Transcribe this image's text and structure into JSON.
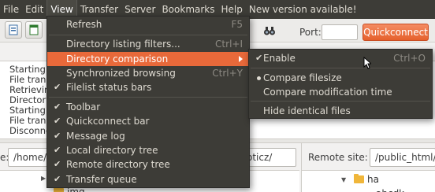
{
  "menubar": {
    "items": [
      "File",
      "Edit",
      "View",
      "Transfer",
      "Server",
      "Bookmarks",
      "Help",
      "New version available!"
    ],
    "active": "View"
  },
  "toolbar": {
    "port_label": "Port:",
    "connect_label": "Quickconnect"
  },
  "log": {
    "lines": [
      "Starting",
      "File trans",
      "Retrievin",
      "Director",
      "Starting",
      "File trans",
      "Disconne"
    ]
  },
  "local": {
    "label": "e:",
    "path": "/home/m",
    "path_tail": "oticz/",
    "tree": [
      {
        "name": "img",
        "type": "folder"
      }
    ]
  },
  "remote": {
    "label": "Remote site:",
    "path": "/public_html/mi",
    "tree": [
      {
        "name": "ha",
        "type": "folder"
      },
      {
        "name": "abcdk",
        "type": "unknown"
      }
    ]
  },
  "view_menu": {
    "items": [
      {
        "label": "Refresh",
        "accel": "F5",
        "check": false
      },
      {
        "sep": true
      },
      {
        "label": "Directory listing filters...",
        "accel": "Ctrl+I",
        "check": false
      },
      {
        "label": "Directory comparison",
        "accel": "",
        "submenu": true,
        "highlighted": true
      },
      {
        "label": "Synchronized browsing",
        "accel": "Ctrl+Y",
        "check": false
      },
      {
        "label": "Filelist status bars",
        "accel": "",
        "check": true
      },
      {
        "sep": true
      },
      {
        "label": "Toolbar",
        "check": true
      },
      {
        "label": "Quickconnect bar",
        "check": true
      },
      {
        "label": "Message log",
        "check": true
      },
      {
        "label": "Local directory tree",
        "check": true
      },
      {
        "label": "Remote directory tree",
        "check": true
      },
      {
        "label": "Transfer queue",
        "check": true
      }
    ]
  },
  "comparison_submenu": {
    "items": [
      {
        "label": "Enable",
        "accel": "Ctrl+O",
        "check": true
      },
      {
        "sep": true
      },
      {
        "label": "Compare filesize",
        "radio": true
      },
      {
        "label": "Compare modification time",
        "radio": false
      },
      {
        "sep": true
      },
      {
        "label": "Hide identical files",
        "check": false
      }
    ]
  },
  "colors": {
    "menu_bg": "#3d3c37",
    "highlight": "#e8693a",
    "menu_text": "#dfdbd2"
  }
}
